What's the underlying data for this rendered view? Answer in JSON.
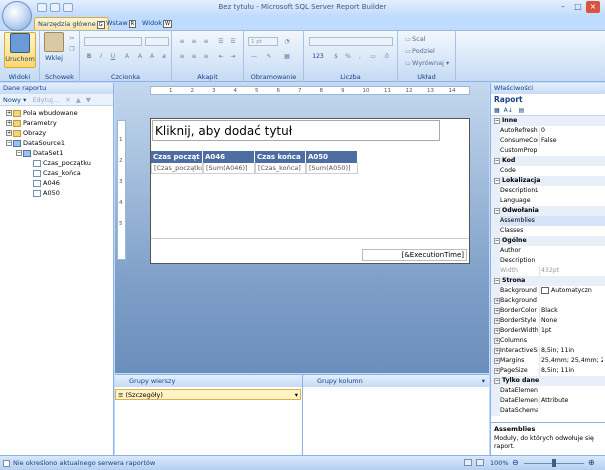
{
  "window": {
    "title": "Bez tytułu - Microsoft SQL Server Report Builder"
  },
  "ribbon_tabs": [
    {
      "label": "Narzędzia główne",
      "key": "G"
    },
    {
      "label": "Wstaw",
      "key": "R"
    },
    {
      "label": "Widok",
      "key": "W"
    }
  ],
  "ribbon": {
    "run_label": "Uruchom",
    "paste_label": "Wklej",
    "groups": {
      "views": "Widoki",
      "clipboard": "Schowek",
      "font": "Czcionka",
      "paragraph": "Akapit",
      "border": "Obramowanie",
      "number": "Liczba",
      "layout": "Układ"
    },
    "border_width": "1 pt",
    "number_format": "123",
    "layout_items": [
      "Scal",
      "Podziel",
      "Wyrównaj"
    ]
  },
  "left_pane": {
    "title": "Dane raportu",
    "new_label": "Nowy",
    "edit_label": "Edytuj...",
    "tree": [
      {
        "label": "Pola wbudowane",
        "level": 0,
        "kind": "folder"
      },
      {
        "label": "Parametry",
        "level": 0,
        "kind": "folder"
      },
      {
        "label": "Obrazy",
        "level": 0,
        "kind": "folder"
      },
      {
        "label": "DataSource1",
        "level": 0,
        "kind": "datasource"
      },
      {
        "label": "DataSet1",
        "level": 1,
        "kind": "dataset"
      },
      {
        "label": "Czas_początku",
        "level": 2,
        "kind": "field"
      },
      {
        "label": "Czas_końca",
        "level": 2,
        "kind": "field"
      },
      {
        "label": "A046",
        "level": 2,
        "kind": "field"
      },
      {
        "label": "A050",
        "level": 2,
        "kind": "field"
      }
    ]
  },
  "ruler": [
    "1",
    "2",
    "3",
    "4",
    "5",
    "6",
    "7",
    "8",
    "9",
    "10",
    "11",
    "12",
    "13",
    "14"
  ],
  "vruler": [
    "1",
    "2",
    "3",
    "4",
    "5"
  ],
  "report": {
    "title_placeholder": "Kliknij, aby dodać tytuł",
    "headers": [
      "Czas począt",
      "A046",
      "Czas końca",
      "A050"
    ],
    "cells": [
      "[Czas_początku",
      "[Sum(A046)]",
      "[Czas_końca]",
      "[Sum(A050)]"
    ],
    "footer_expr": "[&ExecutionTime]"
  },
  "groups": {
    "row_title": "Grupy wierszy",
    "col_title": "Grupy kolumn",
    "row_item": "≡ (Szczegóły)"
  },
  "properties": {
    "title": "Właściwości",
    "object": "Raport",
    "rows": [
      {
        "cat": true,
        "name": "Inne"
      },
      {
        "name": "AutoRefresh",
        "value": "0"
      },
      {
        "name": "ConsumeCor",
        "value": "False"
      },
      {
        "name": "CustomProp",
        "value": ""
      },
      {
        "cat": true,
        "name": "Kod"
      },
      {
        "name": "Code",
        "value": ""
      },
      {
        "cat": true,
        "name": "Lokalizacja"
      },
      {
        "name": "DescriptionL",
        "value": ""
      },
      {
        "name": "Language",
        "value": ""
      },
      {
        "cat": true,
        "name": "Odwołania"
      },
      {
        "name": "Assemblies",
        "value": "",
        "selected": true
      },
      {
        "name": "Classes",
        "value": ""
      },
      {
        "cat": true,
        "name": "Ogólne"
      },
      {
        "name": "Author",
        "value": ""
      },
      {
        "name": "Description",
        "value": ""
      },
      {
        "name": "Width",
        "value": "432pt",
        "disabled": true
      },
      {
        "cat": true,
        "name": "Strona"
      },
      {
        "name": "Background",
        "value": "Automatyczn",
        "swatch": true
      },
      {
        "name": "Background",
        "value": "",
        "plus": true
      },
      {
        "name": "BorderColor",
        "value": "Black",
        "plus": true
      },
      {
        "name": "BorderStyle",
        "value": "None",
        "plus": true
      },
      {
        "name": "BorderWidth",
        "value": "1pt",
        "plus": true
      },
      {
        "name": "Columns",
        "value": "",
        "plus": true
      },
      {
        "name": "InteractiveSi",
        "value": "8,5in; 11in",
        "plus": true
      },
      {
        "name": "Margins",
        "value": "25,4mm; 25,4mm; 2",
        "plus": true
      },
      {
        "name": "PageSize",
        "value": "8,5in; 11in",
        "plus": true
      },
      {
        "cat": true,
        "name": "Tylko dane"
      },
      {
        "name": "DataElement",
        "value": ""
      },
      {
        "name": "DataElement",
        "value": "Attribute"
      },
      {
        "name": "DataSchema",
        "value": ""
      }
    ],
    "help_title": "Assemblies",
    "help_text": "Moduły, do których odwołuje się raport."
  },
  "status": {
    "text": "Nie określono aktualnego serwera raportów",
    "zoom": "100%"
  }
}
